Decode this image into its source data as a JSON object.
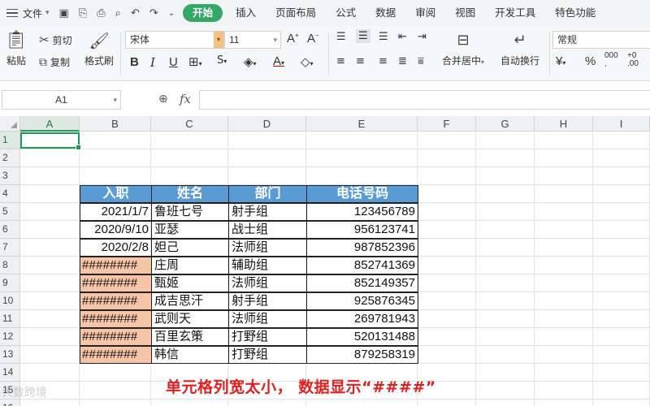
{
  "menubar": {
    "file_label": "文件",
    "tabs": [
      {
        "label": "开始",
        "active": true
      },
      {
        "label": "插入",
        "active": false
      },
      {
        "label": "页面布局",
        "active": false
      },
      {
        "label": "公式",
        "active": false
      },
      {
        "label": "数据",
        "active": false
      },
      {
        "label": "审阅",
        "active": false
      },
      {
        "label": "视图",
        "active": false
      },
      {
        "label": "开发工具",
        "active": false
      },
      {
        "label": "特色功能",
        "active": false
      }
    ],
    "accent_color": "#35a767"
  },
  "ribbon": {
    "paste_label": "粘贴",
    "cut_label": "剪切",
    "copy_label": "复制",
    "format_painter_label": "格式刷",
    "font_name": "宋体",
    "font_size": "11",
    "merge_label": "合并居中",
    "wrap_label": "自动换行",
    "number_format": "常规"
  },
  "formula_bar": {
    "name_box": "A1",
    "fx_label": "fx",
    "formula": ""
  },
  "sheet": {
    "columns": [
      "A",
      "B",
      "C",
      "D",
      "E",
      "F",
      "G",
      "H",
      "I"
    ],
    "selected_column": "A",
    "rows": [
      "1",
      "2",
      "3",
      "4",
      "5",
      "6",
      "7",
      "8",
      "9",
      "10",
      "11",
      "12",
      "13",
      "14",
      "15",
      "16"
    ],
    "selected_row": "1",
    "table_header": [
      "入职",
      "姓名",
      "部门",
      "电话号码"
    ],
    "table_rows": [
      {
        "date": "2021/1/7",
        "name": "鲁班七号",
        "dept": "射手组",
        "phone": "123456789"
      },
      {
        "date": "2020/9/10",
        "name": "亚瑟",
        "dept": "战士组",
        "phone": "956123741"
      },
      {
        "date": "2020/2/8",
        "name": "妲己",
        "dept": "法师组",
        "phone": "987852396"
      },
      {
        "date": "########",
        "name": "庄周",
        "dept": "辅助组",
        "phone": "852741369"
      },
      {
        "date": "########",
        "name": "甄姬",
        "dept": "法师组",
        "phone": "852149357"
      },
      {
        "date": "########",
        "name": "成吉思汗",
        "dept": "射手组",
        "phone": "925876345"
      },
      {
        "date": "########",
        "name": "武则天",
        "dept": "法师组",
        "phone": "269781943"
      },
      {
        "date": "########",
        "name": "百里玄策",
        "dept": "打野组",
        "phone": "520131488"
      },
      {
        "date": "########",
        "name": "韩信",
        "dept": "打野组",
        "phone": "879258319"
      }
    ],
    "header_color": "#5b9bd5",
    "hash_highlight_color": "#f6c4a6"
  },
  "caption": "单元格列宽太小，  数据显示“####”",
  "watermark": "大数跨境"
}
